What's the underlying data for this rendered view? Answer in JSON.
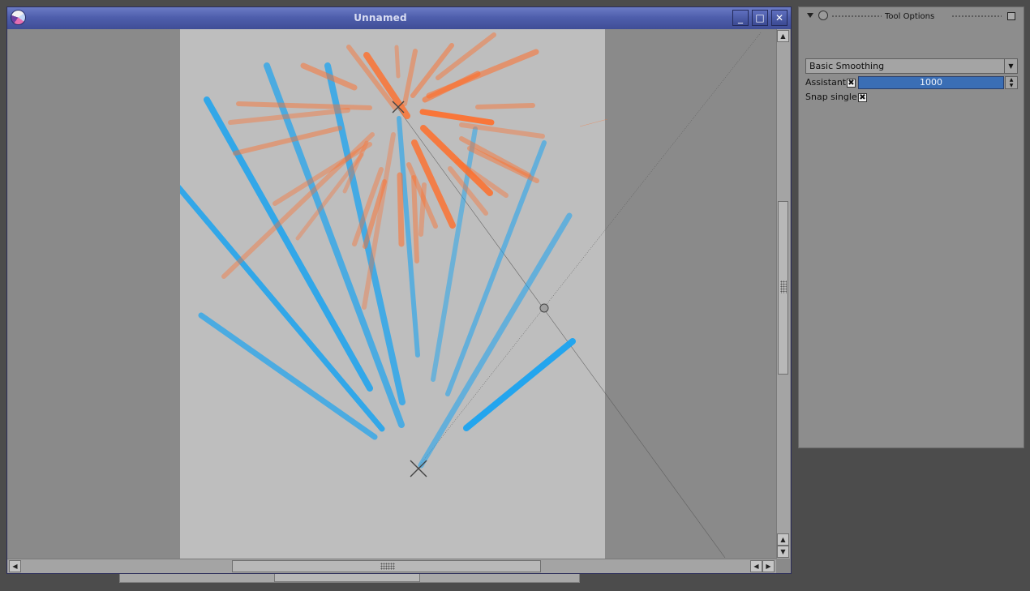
{
  "window": {
    "title": "Unnamed"
  },
  "window_controls": {
    "minimize_glyph": "_",
    "maximize_glyph": "□",
    "close_glyph": "✕"
  },
  "scrollbar_glyphs": {
    "up": "▲",
    "down": "▼",
    "left": "◀",
    "right": "▶"
  },
  "tool_options": {
    "title": "Tool Options",
    "smoothing_mode": "Basic Smoothing",
    "dropdown_glyph": "▼",
    "assistant_label": "Assistant:",
    "assistant_checked_glyph": "✖",
    "assistant_value": "1000",
    "spin_up_glyph": "▲",
    "spin_down_glyph": "▼",
    "snap_single_label": "Snap single:",
    "snap_single_checked_glyph": "✖"
  },
  "colors": {
    "titlebar": "#4f5fad",
    "paper": "#bebebe",
    "blue_stroke": "#1aa3f0",
    "orange_stroke": "#ff6e2a",
    "assistant_field": "#3a6eb5"
  },
  "icons": {
    "app": "krita-app-icon",
    "minimize": "minimize-icon",
    "maximize": "maximize-icon",
    "close": "close-icon",
    "collapse": "triangle-down-icon",
    "lock": "lock-icon",
    "float": "float-docker-icon"
  }
}
